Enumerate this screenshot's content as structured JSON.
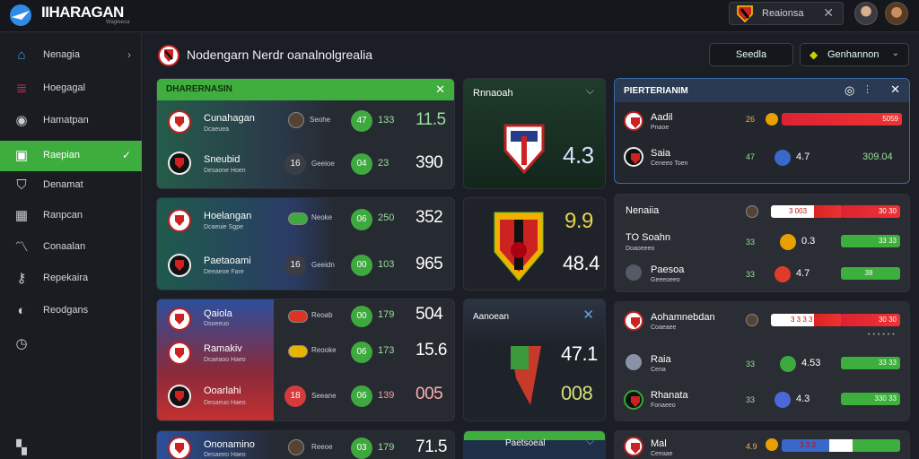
{
  "app": {
    "title": "IIHARAGAN",
    "subtitle": "Wagleesa"
  },
  "top": {
    "search_text": "Reaionsa",
    "close": "✕"
  },
  "sidebar": {
    "items": [
      {
        "label": "Nenagia",
        "icon": "home-icon",
        "chevron": "›"
      },
      {
        "label": "Hoegagal",
        "icon": "flag-icon"
      },
      {
        "label": "Hamatpan",
        "icon": "target-icon"
      },
      {
        "label": "Raepian",
        "icon": "monitor-icon",
        "chevron": "✓"
      },
      {
        "label": "Denamat",
        "icon": "shield-icon"
      },
      {
        "label": "Ranpcan",
        "icon": "grid-icon"
      },
      {
        "label": "Conaalan",
        "icon": "chart-icon"
      },
      {
        "label": "Repekaira",
        "icon": "key-icon"
      },
      {
        "label": "Reodgans",
        "icon": "ball-icon"
      }
    ]
  },
  "page": {
    "title": "Nodengarn Nerdr oanalnolgrealia",
    "search_label": "Seedla",
    "filter_label": "Genhannon",
    "filter_chevron": "⌄"
  },
  "card1": {
    "title": "DHARERNASIN",
    "close": "✕",
    "matches": [
      {
        "team": "Cunahagan",
        "sub": "Dcaeuea",
        "mini_label": "Seohe",
        "circle": "47",
        "mid": "133",
        "big": "11.5"
      },
      {
        "team": "Sneubid",
        "sub": "Desaone Hoen",
        "mini_label": "Geeioe",
        "mini_num": "16",
        "circle": "04",
        "mid": "23",
        "big": "390"
      }
    ]
  },
  "card2": {
    "matches": [
      {
        "team": "Hoelangan",
        "sub": "Dcaeuie Sgpe",
        "mini_label": "Neoke",
        "circle": "06",
        "mid": "250",
        "big": "352"
      },
      {
        "team": "Paetaoami",
        "sub": "Deeaeoe Fare",
        "mini_label": "Geeidn",
        "mini_num": "16",
        "circle": "00",
        "mid": "103",
        "big": "965"
      }
    ]
  },
  "card3": {
    "matches": [
      {
        "team": "Qaiola",
        "sub": "Dsoeeuo",
        "mini_label": "Reoab",
        "circle": "00",
        "mid": "179",
        "big": "504"
      },
      {
        "team": "Ramakiv",
        "sub": "Dcaeaoo Haeo",
        "mini_label": "Reooke",
        "circle": "06",
        "mid": "173",
        "big": "15.6"
      },
      {
        "team": "Ooarlahi",
        "sub": "Desaeuo Haeo",
        "mini_label": "Seeane",
        "mini_num": "18",
        "circle": "06",
        "mid": "139",
        "big": "005"
      }
    ]
  },
  "card4": {
    "matches": [
      {
        "team": "Ononamino",
        "sub": "Desaeeo Haeo",
        "mini_label": "Reeoe",
        "circle": "03",
        "mid": "179",
        "big": "71.5"
      }
    ]
  },
  "mid1": {
    "title": "Rnnaoah",
    "value": "4.3"
  },
  "mid2": {
    "v1": "9.9",
    "v2": "48.4"
  },
  "mid3": {
    "title": "Aanoean",
    "close": "✕",
    "v1": "47.1",
    "v2": "008"
  },
  "mid4": {
    "title": "Paetsoeal"
  },
  "right1": {
    "title": "PIERTERIANIM",
    "rows": [
      {
        "team": "Aadil",
        "sub": "Pnaoe",
        "score": "26",
        "bar": "5059"
      },
      {
        "team": "Saia",
        "sub": "Ceneeo Toen",
        "score": "47",
        "val": "4.7",
        "green_val": "309.04"
      }
    ]
  },
  "right2": {
    "rows": [
      {
        "team": "Nenaiia",
        "sub": "",
        "bar": "3 003",
        "bar2": "30 30"
      },
      {
        "team": "TO Soahn",
        "sub": "Doaoeeeo",
        "score": "33",
        "val": "0.3",
        "bar": "33 33"
      },
      {
        "team": "Paesoa",
        "sub": "Geeeoeeo",
        "score": "33",
        "val": "4.7",
        "bar": "38"
      }
    ]
  },
  "right3": {
    "rows": [
      {
        "team": "Aohamnebdan",
        "sub": "Coaeaee",
        "bar": "3 3 3 3",
        "bar2": "30 30"
      },
      {
        "team": "Raia",
        "sub": "Cena",
        "score": "33",
        "val": "4.53",
        "bar": "33 33"
      },
      {
        "team": "Rhanata",
        "sub": "Fonaeeo",
        "score": "33",
        "val": "4.3",
        "bar": "330 33"
      }
    ]
  },
  "right4": {
    "rows": [
      {
        "team": "Mal",
        "sub": "Ceeaae",
        "score": "4.9",
        "bar": "3 3 3"
      }
    ]
  },
  "colors": {
    "accent": "#3fae3f",
    "danger": "#dd2233",
    "bg": "#1b1e25"
  }
}
